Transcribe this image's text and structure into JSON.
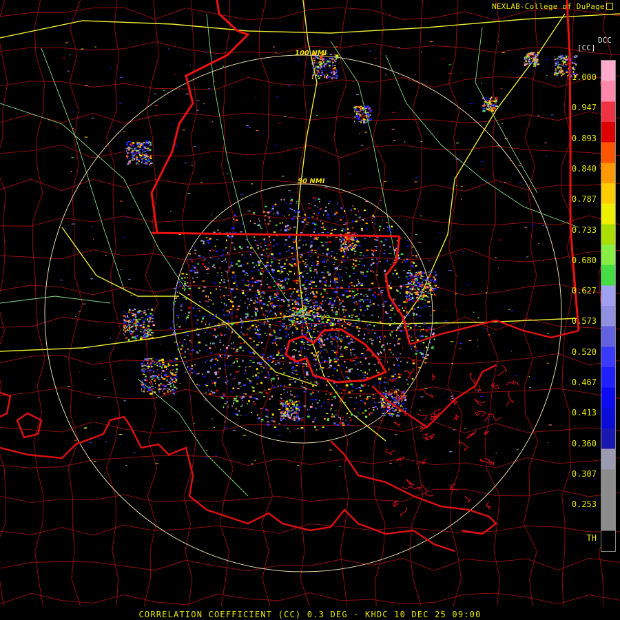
{
  "header": {
    "credit": "NEXLAB-College of DuPage",
    "credit_icon": "box-icon"
  },
  "legend": {
    "product_code": "DCC",
    "unit": "[CC]",
    "ticks": [
      "1.000",
      "0.947",
      "0.893",
      "0.840",
      "0.787",
      "0.733",
      "0.680",
      "0.627",
      "0.573",
      "0.520",
      "0.467",
      "0.413",
      "0.360",
      "0.307",
      "0.253",
      "TH"
    ],
    "colors": [
      "#000000",
      "#8c8c8c",
      "#8c8c8c",
      "#8c8c8c",
      "#9a9ab0",
      "#1818b0",
      "#0c0cd8",
      "#0c0cf0",
      "#2020ff",
      "#3a3aff",
      "#6262e0",
      "#9090e0",
      "#a0a0f0",
      "#44dd44",
      "#88ee44",
      "#aadd00",
      "#eeee00",
      "#ffcc00",
      "#ff9900",
      "#ff5500",
      "#dd0000",
      "#ee3344",
      "#ff88aa",
      "#ffaacc"
    ]
  },
  "map": {
    "ring_labels": [
      "100 NMI",
      "50 NMI"
    ],
    "colors": {
      "state_border": "#ee1111",
      "county_border": "#b01010",
      "coastline": "#dd1111",
      "highway_major": "#eeee33",
      "highway_minor": "#88dd88",
      "range_ring": "#e8d9a8"
    }
  },
  "footer": {
    "title": "CORRELATION COEFFICIENT (CC) 0.3 DEG - KHDC 10 DEC 25 09:00"
  }
}
